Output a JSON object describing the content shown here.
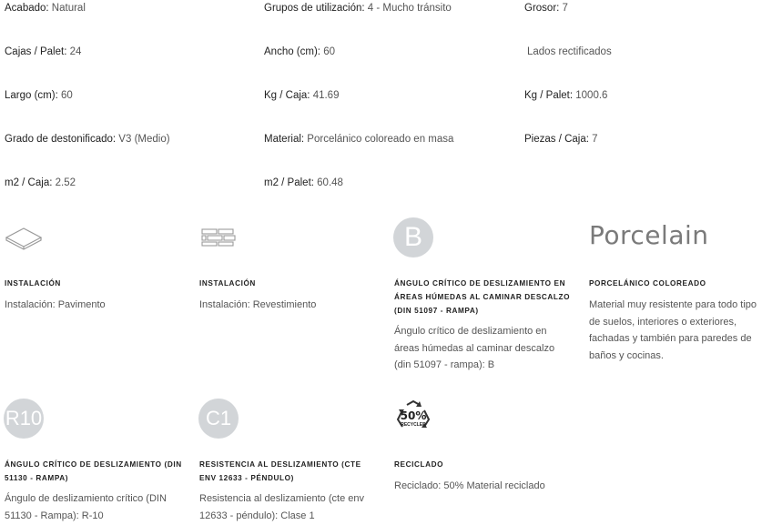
{
  "specs": {
    "acabado": {
      "label": "Acabado:",
      "value": " Natural"
    },
    "grupos": {
      "label": "Grupos de utilización:",
      "value": " 4 - Mucho tránsito"
    },
    "grosor": {
      "label": "Grosor:",
      "value": " 7"
    },
    "cajas_palet": {
      "label": "Cajas / Palet:",
      "value": " 24"
    },
    "ancho": {
      "label": "Ancho (cm):",
      "value": " 60"
    },
    "lados": {
      "label": "",
      "value": "Lados rectificados"
    },
    "largo": {
      "label": "Largo (cm):",
      "value": " 60"
    },
    "kg_caja": {
      "label": "Kg / Caja:",
      "value": " 41.69"
    },
    "kg_palet": {
      "label": "Kg / Palet:",
      "value": " 1000.6"
    },
    "destonificado": {
      "label": "Grado de destonificado:",
      "value": " V3 (Medio)"
    },
    "material": {
      "label": "Material:",
      "value": " Porcelánico coloreado en masa"
    },
    "piezas_caja": {
      "label": "Piezas / Caja:",
      "value": " 7"
    },
    "m2_caja": {
      "label": "m2 / Caja:",
      "value": " 2.52"
    },
    "m2_palet": {
      "label": "m2 / Palet:",
      "value": " 60.48"
    }
  },
  "features": {
    "pavimento": {
      "icon": "floor-tile-icon",
      "title": "INSTALACIÓN",
      "desc": "Instalación: Pavimento"
    },
    "revestimiento": {
      "icon": "wall-bricks-icon",
      "title": "INSTALACIÓN",
      "desc": "Instalación: Revestimiento"
    },
    "din51097": {
      "icon_text": "B",
      "title": "ÁNGULO CRÍTICO DE DESLIZAMIENTO EN ÁREAS HÚMEDAS AL CAMINAR DESCALZO (DIN 51097 - RAMPA)",
      "desc": "Ángulo crítico de deslizamiento en áreas húmedas al caminar descalzo (din 51097 - rampa): B"
    },
    "porcelanico": {
      "logo_text": "Porcelain",
      "title": "PORCELÁNICO COLOREADO",
      "desc": "Material muy resistente para todo tipo de suelos, interiores o exteriores, fachadas y también para paredes de baños y cocinas."
    },
    "din51130": {
      "icon_text": "R10",
      "title": "ÁNGULO CRÍTICO DE DESLIZAMIENTO (DIN 51130 - RAMPA)",
      "desc": "Ángulo de deslizamiento crítico (DIN 51130 - Rampa): R-10"
    },
    "cte": {
      "icon_text": "C1",
      "title": "RESISTENCIA AL DESLIZAMIENTO (CTE ENV 12633 - PÉNDULO)",
      "desc": "Resistencia al deslizamiento (cte env 12633 - péndulo): Clase 1"
    },
    "reciclado": {
      "icon": "recycled-icon",
      "icon_percent": "50%",
      "icon_label": "RECYCLED",
      "title": "RECICLADO",
      "desc": "Reciclado: 50% Material reciclado"
    }
  },
  "colors": {
    "badge": "#d2d5d8",
    "logo": "#7a7a7a"
  }
}
